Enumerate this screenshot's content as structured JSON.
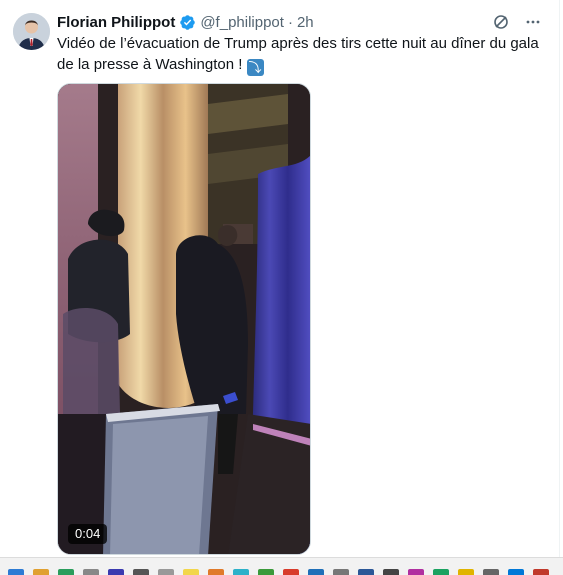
{
  "tweet": {
    "author_name": "Florian Philippot",
    "handle": "@f_philippot",
    "separator": "·",
    "time": "2h",
    "text": "Vidéo de l’évacuation de Trump après des tirs cette nuit au dîner du gala de la presse à Washington !",
    "emoji": "⤵",
    "verified_icon": "verified-badge-icon",
    "top_icons": [
      "grok-icon",
      "more-icon"
    ]
  },
  "video": {
    "duration": "0:04"
  },
  "colors": {
    "accent": "#1d9bf0",
    "secondary_text": "#536471"
  },
  "taskbar": {
    "icons": [
      "app-icon-1",
      "app-icon-2",
      "app-icon-3",
      "app-icon-4",
      "app-icon-5",
      "app-icon-6",
      "app-icon-7",
      "app-icon-8",
      "app-icon-9",
      "app-icon-10",
      "app-icon-11",
      "app-icon-12",
      "app-icon-13",
      "app-icon-14",
      "app-icon-15",
      "app-icon-16",
      "app-icon-17",
      "app-icon-18",
      "app-icon-19",
      "app-icon-20",
      "app-icon-21",
      "app-icon-22"
    ]
  }
}
